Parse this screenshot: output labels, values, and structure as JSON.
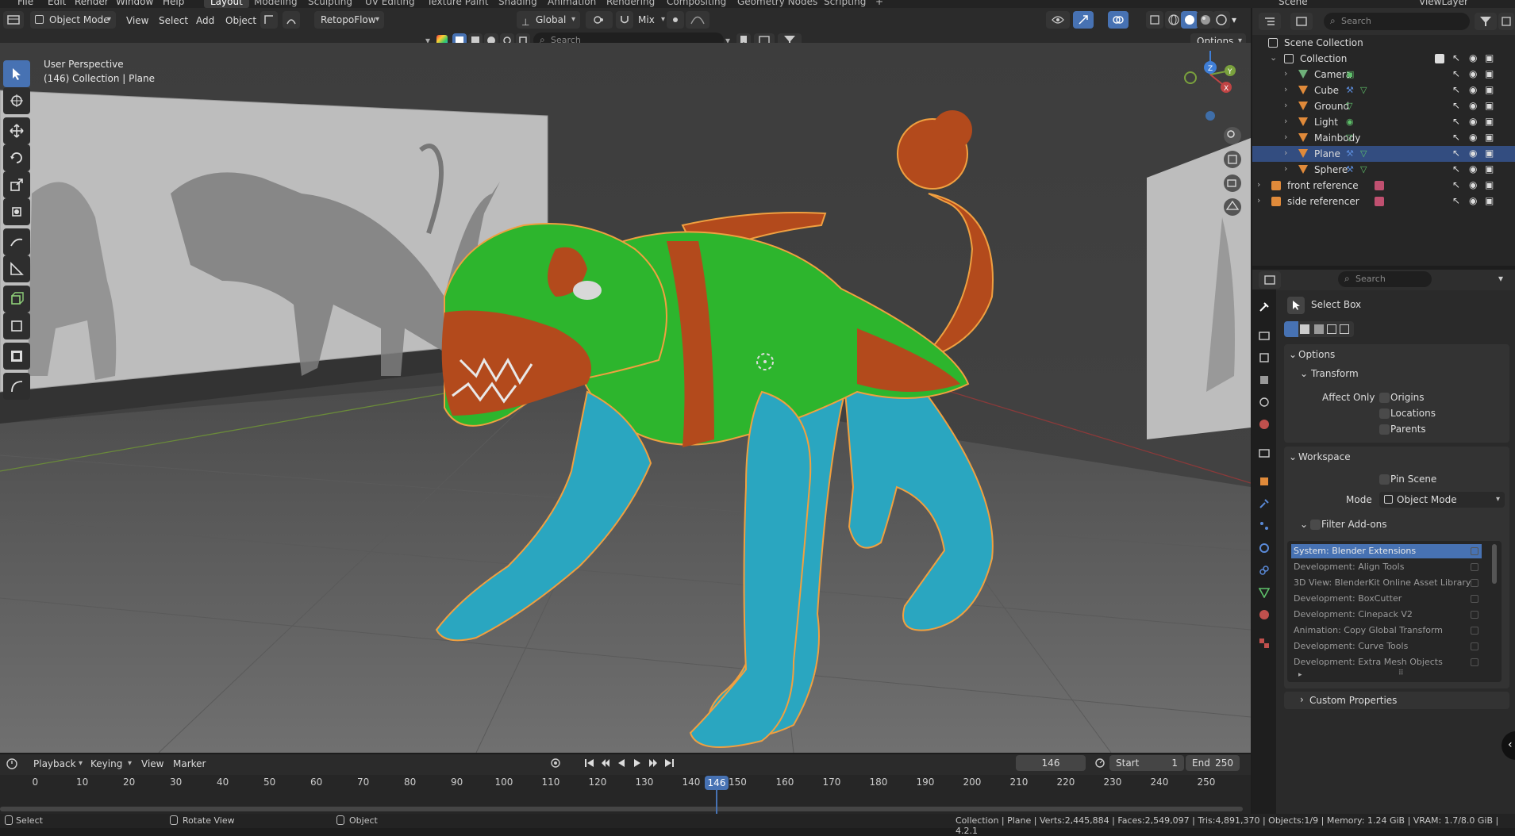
{
  "top_menu": [
    "File",
    "Edit",
    "Render",
    "Window",
    "Help"
  ],
  "workspaces": [
    "Layout",
    "Modeling",
    "Sculpting",
    "UV Editing",
    "Texture Paint",
    "Shading",
    "Animation",
    "Rendering",
    "Compositing",
    "Geometry Nodes",
    "Scripting"
  ],
  "active_workspace": "Layout",
  "scene_name": "Scene",
  "view_layer": "ViewLayer",
  "viewport_header": {
    "mode": "Object Mode",
    "menus": [
      "View",
      "Select",
      "Add",
      "Object"
    ],
    "addon_menu": "RetopoFlow",
    "orientation": "Global",
    "snap_label": "Mix",
    "search_placeholder": "Search",
    "options_label": "Options"
  },
  "viewport": {
    "perspective": "User Perspective",
    "info": "(146) Collection | Plane",
    "gizmo_axes": [
      "Z",
      "Y",
      "X"
    ]
  },
  "outliner": {
    "search_placeholder": "Search",
    "items": [
      {
        "name": "Scene Collection",
        "level": 0
      },
      {
        "name": "Collection",
        "level": 1
      },
      {
        "name": "Camera",
        "level": 2
      },
      {
        "name": "Cube",
        "level": 2
      },
      {
        "name": "Ground",
        "level": 2
      },
      {
        "name": "Light",
        "level": 2
      },
      {
        "name": "Mainbody",
        "level": 2
      },
      {
        "name": "Plane",
        "level": 2,
        "selected": true
      },
      {
        "name": "Sphere",
        "level": 2
      },
      {
        "name": "front reference",
        "level": 1
      },
      {
        "name": "side referencer",
        "level": 1
      }
    ]
  },
  "properties": {
    "search_placeholder": "Search",
    "tool_name": "Select Box",
    "options_panel": "Options",
    "transform_panel": "Transform",
    "affect_only_label": "Affect Only",
    "affect_only": [
      "Origins",
      "Locations",
      "Parents"
    ],
    "workspace_panel": "Workspace",
    "pin_scene": "Pin Scene",
    "mode_label": "Mode",
    "mode_value": "Object Mode",
    "filter_addons": "Filter Add-ons",
    "addons": [
      "System: Blender Extensions",
      "Development: Align Tools",
      "3D View: BlenderKit Online Asset Library",
      "Development: BoxCutter",
      "Development: Cinepack V2",
      "Animation: Copy Global Transform",
      "Development: Curve Tools",
      "Development: Extra Mesh Objects"
    ],
    "custom_properties": "Custom Properties"
  },
  "timeline": {
    "menus": [
      "Playback",
      "Keying",
      "View",
      "Marker"
    ],
    "current_frame": "146",
    "start_label": "Start",
    "start": "1",
    "end_label": "End",
    "end": "250",
    "ticks": [
      "0",
      "10",
      "20",
      "30",
      "40",
      "50",
      "60",
      "70",
      "80",
      "90",
      "100",
      "110",
      "120",
      "130",
      "140",
      "150",
      "160",
      "170",
      "180",
      "190",
      "200",
      "210",
      "220",
      "230",
      "240",
      "250"
    ]
  },
  "status_bar": {
    "select": "Select",
    "rotate": "Rotate View",
    "object": "Object",
    "stats": "Collection | Plane | Verts:2,445,884 | Faces:2,549,097 | Tris:4,891,370 | Objects:1/9 | Memory: 1.24 GiB | VRAM: 1.7/8.0 GiB | 4.2.1"
  },
  "colors": {
    "accent": "#4772b3",
    "green_mask": "#2db52d",
    "orange_mask": "#b34a1c",
    "blue_mask": "#2aa6c0",
    "selection_outline": "#f0a040"
  }
}
